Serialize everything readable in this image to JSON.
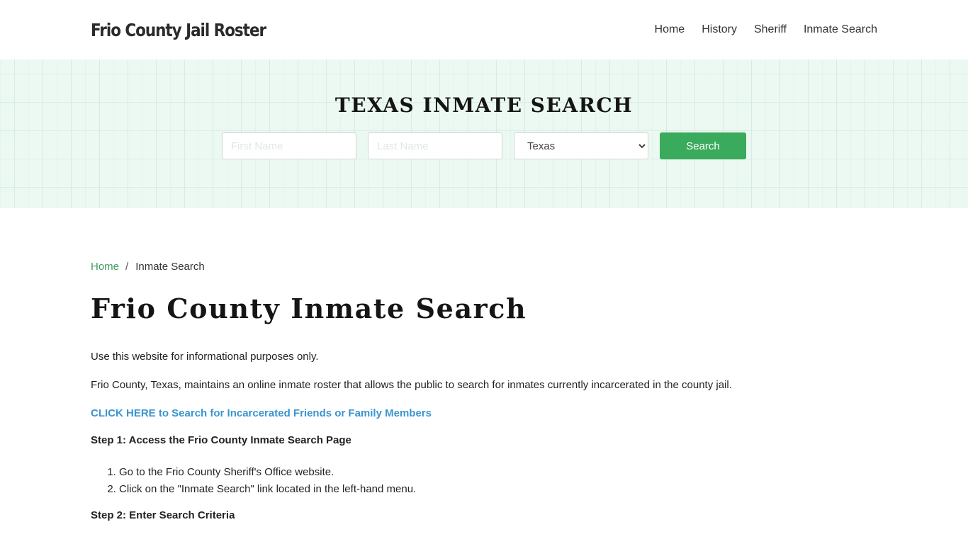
{
  "header": {
    "brand": "Frio County Jail Roster",
    "nav": [
      {
        "label": "Home"
      },
      {
        "label": "History"
      },
      {
        "label": "Sheriff"
      },
      {
        "label": "Inmate Search"
      }
    ]
  },
  "hero": {
    "title": "TEXAS INMATE SEARCH",
    "first_name_placeholder": "First Name",
    "last_name_placeholder": "Last Name",
    "state_selected": "Texas",
    "search_label": "Search",
    "background_color": "#ebf9f2",
    "button_color": "#3aaa5c"
  },
  "breadcrumb": {
    "home": "Home",
    "separator": "/",
    "current": "Inmate Search"
  },
  "content": {
    "title": "Frio County Inmate Search",
    "disclaimer": "Use this website for informational purposes only.",
    "intro": "Frio County, Texas, maintains an online inmate roster that allows the public to search for inmates currently incarcerated in the county jail.",
    "cta": "CLICK HERE to Search for Incarcerated Friends or Family Members",
    "step1_heading": "Step 1: Access the Frio County Inmate Search Page",
    "step1_items": [
      "Go to the Frio County Sheriff's Office website.",
      "Click on the \"Inmate Search\" link located in the left-hand menu."
    ],
    "step2_heading": "Step 2: Enter Search Criteria",
    "link_color": "#3a95cf"
  }
}
